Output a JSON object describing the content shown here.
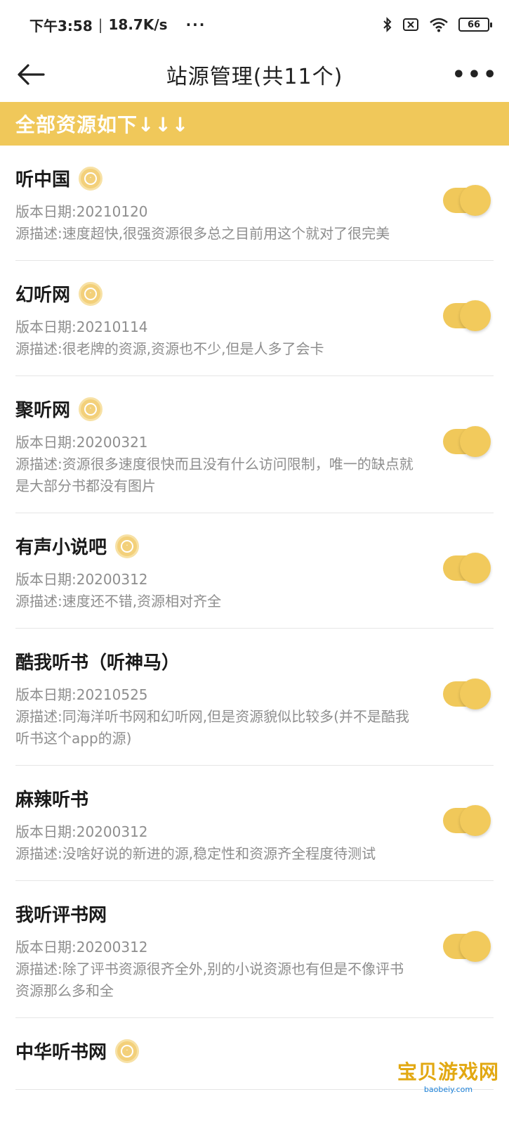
{
  "status_bar": {
    "time": "下午3:58",
    "speed": "18.7K/s",
    "dots": "···",
    "battery": "66"
  },
  "header": {
    "title": "站源管理(共11个)",
    "more": "•••"
  },
  "banner": {
    "text": "全部资源如下↓↓↓"
  },
  "sources": [
    {
      "name": "听中国",
      "date": "版本日期:20210120",
      "desc": "源描述:速度超快,很强资源很多总之目前用这个就对了很完美",
      "badge": true
    },
    {
      "name": "幻听网",
      "date": "版本日期:20210114",
      "desc": "源描述:很老牌的资源,资源也不少,但是人多了会卡",
      "badge": true
    },
    {
      "name": "聚听网",
      "date": "版本日期:20200321",
      "desc": "源描述:资源很多速度很快而且没有什么访问限制，唯一的缺点就是大部分书都没有图片",
      "badge": true
    },
    {
      "name": "有声小说吧",
      "date": "版本日期:20200312",
      "desc": "源描述:速度还不错,资源相对齐全",
      "badge": true
    },
    {
      "name": "酷我听书（听神马）",
      "date": "版本日期:20210525",
      "desc": "源描述:同海洋听书网和幻听网,但是资源貌似比较多(并不是酷我听书这个app的源)",
      "badge": false
    },
    {
      "name": "麻辣听书",
      "date": "版本日期:20200312",
      "desc": "源描述:没啥好说的新进的源,稳定性和资源齐全程度待测试",
      "badge": false
    },
    {
      "name": "我听评书网",
      "date": "版本日期:20200312",
      "desc": "源描述:除了评书资源很齐全外,别的小说资源也有但是不像评书资源那么多和全",
      "badge": false
    },
    {
      "name": "中华听书网",
      "date": "",
      "desc": "",
      "badge": true
    }
  ],
  "watermark": {
    "main": "宝贝游戏网",
    "sub": "baobeiy.com"
  },
  "colors": {
    "accent": "#f0c85a",
    "text_secondary": "#8e8e8e"
  }
}
